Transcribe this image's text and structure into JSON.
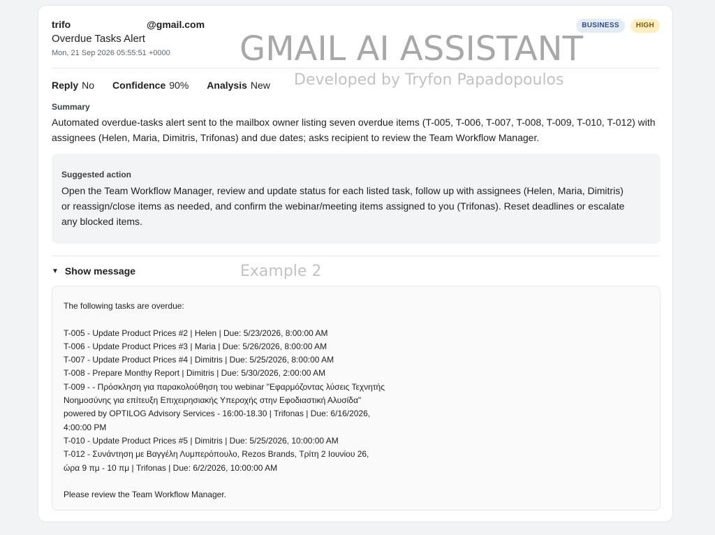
{
  "email": {
    "from": "trifo                            @gmail.com",
    "subject": "Overdue Tasks Alert",
    "date": "Mon, 21 Sep 2026 05:55:51 +0000",
    "badges": [
      "BUSINESS",
      "HIGH"
    ]
  },
  "watermark": {
    "title": "GMAIL AI ASSISTANT",
    "subtitle": "Developed by Tryfon Papadopoulos",
    "example": "Example 2"
  },
  "meta": {
    "reply_label": "Reply",
    "reply_value": "No",
    "confidence_label": "Confidence",
    "confidence_value": "90%",
    "analysis_label": "Analysis",
    "analysis_value": "New"
  },
  "summary": {
    "heading": "Summary",
    "text": "Automated overdue-tasks alert sent to the mailbox owner listing seven overdue items (T-005, T-006, T-007, T-008, T-009, T-010, T-012) with assignees (Helen, Maria, Dimitris, Trifonas) and due dates; asks recipient to review the Team Workflow Manager."
  },
  "action": {
    "heading": "Suggested action",
    "text": "Open the Team Workflow Manager, review and update status for each listed task, follow up with assignees (Helen, Maria, Dimitris) or reassign/close items as needed, and confirm the webinar/meeting items assigned to you (Trifonas). Reset deadlines or escalate any blocked items."
  },
  "message": {
    "toggle_label": "Show message",
    "intro": "The following tasks are overdue:",
    "lines": [
      "T-005 - Update Product Prices #2 | Helen | Due: 5/23/2026, 8:00:00 AM",
      "T-006 - Update Product Prices #3 | Maria | Due: 5/26/2026, 8:00:00 AM",
      "T-007 - Update Product Prices #4 | Dimitris | Due: 5/25/2026, 8:00:00 AM",
      "T-008 - Prepare Monthy Report | Dimitris | Due: 5/30/2026, 2:00:00 AM",
      "T-009 - - Πρόσκληση για παρακολούθηση του webinar \"Εφαρμόζοντας λύσεις Τεχνητής Νοημοσύνης για επίτευξη Επιχειρησιακής Υπεροχής στην Εφοδιαστική Αλυσίδα\" powered by OPTILOG Advisory Services - 16:00-18.30 | Trifonas | Due: 6/16/2026, 4:00:00 PM",
      "T-010 - Update Product Prices #5 | Dimitris | Due: 5/25/2026, 10:00:00 AM",
      "T-012 - Συνάντηση με Βαγγέλη Λυμπερόπουλο, Rezos Brands, Τρίτη 2 Ιουνίου 26, ώρα 9 πμ - 10 πμ | Trifonas | Due: 6/2/2026, 10:00:00 AM"
    ],
    "outro": "Please review the Team Workflow Manager."
  }
}
